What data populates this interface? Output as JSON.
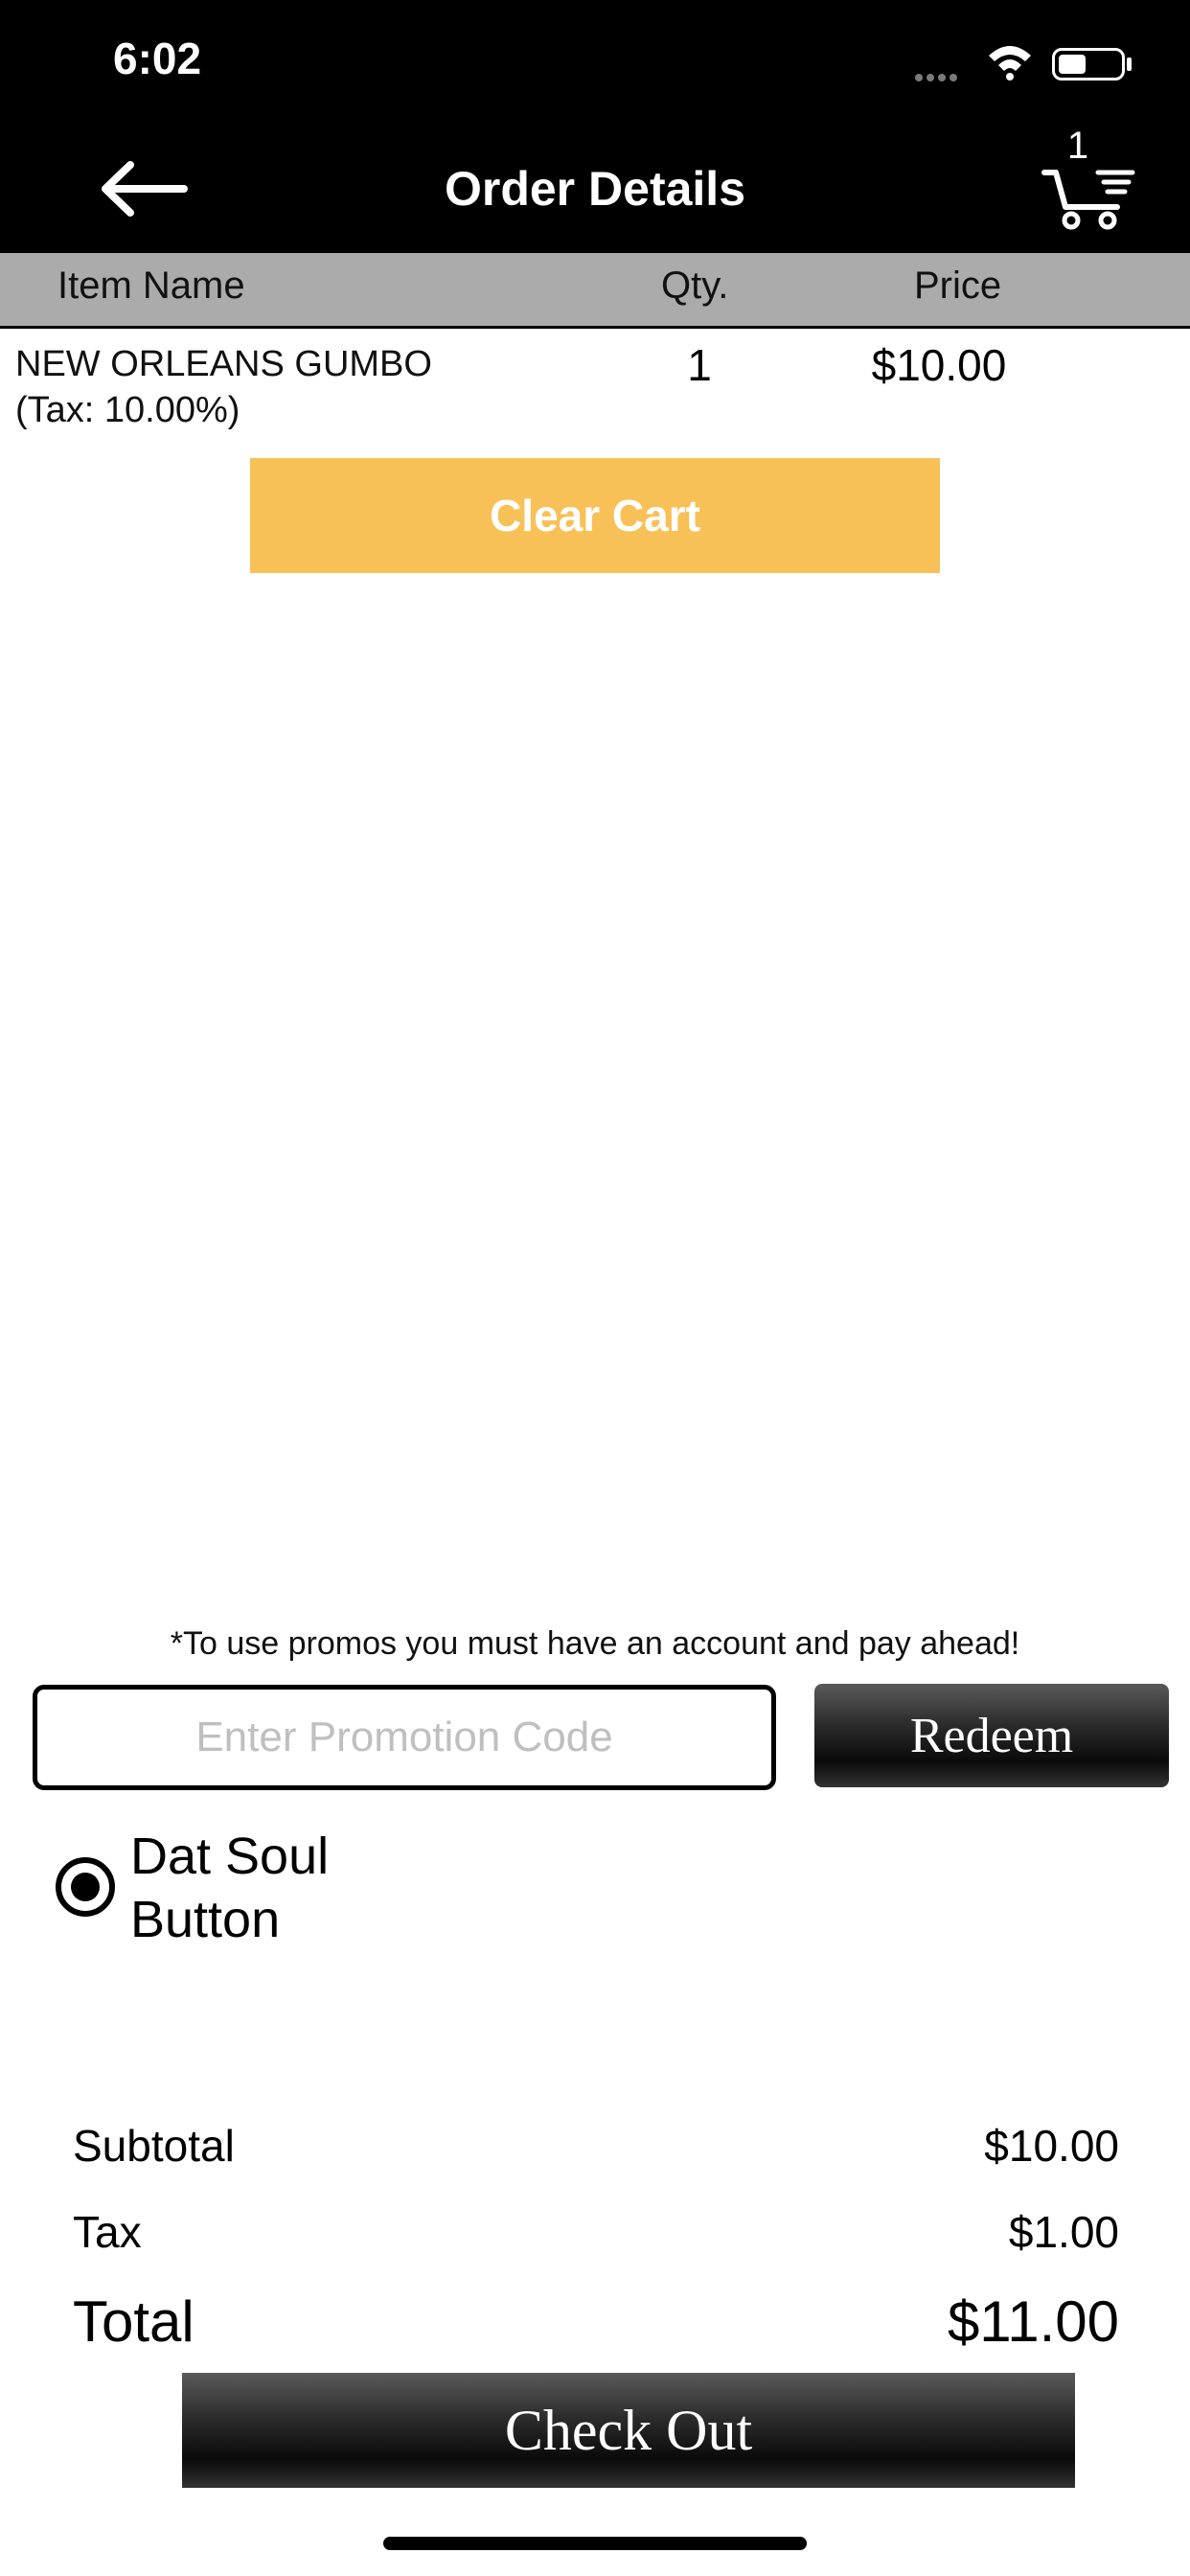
{
  "status_bar": {
    "time": "6:02"
  },
  "header": {
    "title": "Order Details",
    "cart_count": "1"
  },
  "table": {
    "headers": {
      "item_name": "Item Name",
      "qty": "Qty.",
      "price": "Price"
    },
    "rows": [
      {
        "name": "NEW ORLEANS GUMBO",
        "tax": "(Tax: 10.00%)",
        "qty": "1",
        "price": "$10.00"
      }
    ]
  },
  "actions": {
    "clear_cart": "Clear Cart"
  },
  "promo": {
    "note": "*To use promos you must have an account and pay ahead!",
    "placeholder": "Enter Promotion Code",
    "redeem": "Redeem"
  },
  "option": {
    "label_line1": "Dat Soul",
    "label_line2": "Button",
    "selected": true
  },
  "summary": {
    "subtotal_label": "Subtotal",
    "subtotal": "$10.00",
    "tax_label": "Tax",
    "tax": "$1.00",
    "total_label": "Total",
    "total": "$11.00"
  },
  "checkout": {
    "label": "Check Out"
  },
  "icons": [
    "back-arrow-icon",
    "cart-icon",
    "wifi-icon",
    "battery-icon",
    "signal-icon"
  ]
}
